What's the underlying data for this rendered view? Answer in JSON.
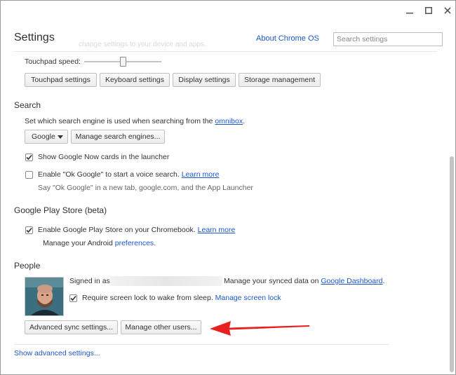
{
  "window": {
    "minimize": "—",
    "maximize": "□",
    "close": "✕"
  },
  "header": {
    "title": "Settings",
    "ghost_text": "change settings to your device and apps.",
    "about_link": "About Chrome OS",
    "search_placeholder": "Search settings"
  },
  "device": {
    "touchpad_speed_label": "Touchpad speed:",
    "touchpad_speed_level": 0.5,
    "buttons": [
      "Touchpad settings",
      "Keyboard settings",
      "Display settings",
      "Storage management"
    ]
  },
  "search_section": {
    "title": "Search",
    "desc_pre": "Set which search engine is used when searching from the ",
    "desc_link": "omnibox",
    "desc_post": ".",
    "engine_select": "Google",
    "manage_engines_button": "Manage search engines...",
    "now_cards": {
      "label": "Show Google Now cards in the launcher",
      "checked": true
    },
    "ok_google": {
      "label": "Enable \"Ok Google\" to start a voice search.",
      "link": "Learn more",
      "checked": false
    },
    "ok_google_hint": "Say \"Ok Google\" in a new tab, google.com, and the App Launcher"
  },
  "play_section": {
    "title": "Google Play Store (beta)",
    "enable": {
      "label": "Enable Google Play Store on your Chromebook.",
      "link": "Learn more",
      "checked": true
    },
    "manage_pre": "Manage your Android ",
    "manage_link": "preferences",
    "manage_post": "."
  },
  "people_section": {
    "title": "People",
    "signed_in": "Signed in as",
    "synced_pre": "Manage your synced data on ",
    "synced_link": "Google Dashboard",
    "synced_post": ".",
    "screen_lock": {
      "label": "Require screen lock to wake from sleep.",
      "link": "Manage screen lock",
      "checked": true
    },
    "advanced_sync_button": "Advanced sync settings...",
    "manage_users_button": "Manage other users..."
  },
  "footer": {
    "advanced_link": "Show advanced settings..."
  },
  "colors": {
    "link": "#1a57c9",
    "arrow": "#e8201f"
  }
}
